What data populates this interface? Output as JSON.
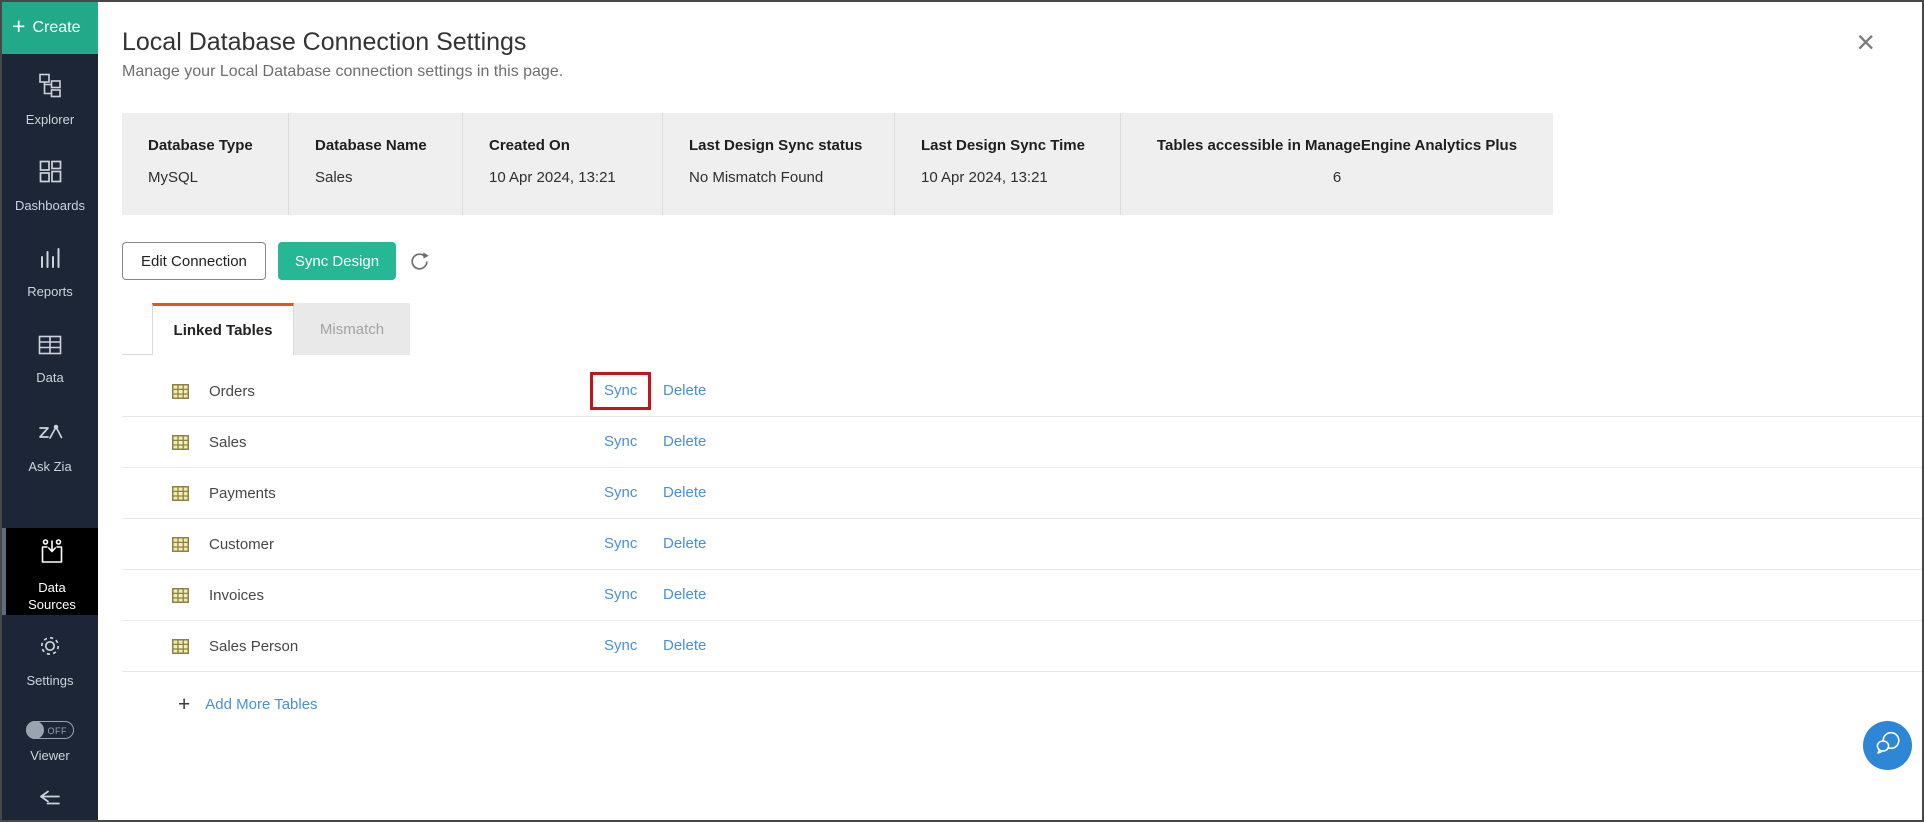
{
  "colors": {
    "accent-green": "#22a98a",
    "sync-green": "#26b795",
    "tab-orange": "#e2571d",
    "link-blue": "#4a90d9",
    "highlight-red": "#c3161c",
    "fab-blue": "#2e86d6",
    "sidebar-bg": "#1d2637",
    "sidebar-active-bg": "#000000",
    "sidebar-text": "#cdd3dc"
  },
  "icons": {
    "plus": "+",
    "close": "×"
  },
  "sidebar": {
    "create_label": "Create",
    "items": [
      {
        "label": "Explorer"
      },
      {
        "label": "Dashboards"
      },
      {
        "label": "Reports"
      },
      {
        "label": "Data"
      },
      {
        "label": "Ask Zia"
      },
      {
        "label": "Data Sources"
      },
      {
        "label": "Settings"
      },
      {
        "label": "Viewer",
        "toggle": "OFF"
      }
    ]
  },
  "header": {
    "title": "Local Database Connection Settings",
    "subtitle": "Manage your Local Database connection settings in this page."
  },
  "info_bar": [
    {
      "label": "Database Type",
      "value": "MySQL"
    },
    {
      "label": "Database Name",
      "value": "Sales"
    },
    {
      "label": "Created On",
      "value": "10 Apr 2024, 13:21"
    },
    {
      "label": "Last Design Sync status",
      "value": "No Mismatch Found"
    },
    {
      "label": "Last Design Sync Time",
      "value": "10 Apr 2024, 13:21"
    },
    {
      "label": "Tables accessible in ManageEngine Analytics Plus",
      "value": "6"
    }
  ],
  "actions": {
    "edit_connection": "Edit Connection",
    "sync_design": "Sync Design"
  },
  "tabs": [
    {
      "label": "Linked Tables"
    },
    {
      "label": "Mismatch"
    }
  ],
  "tables": [
    {
      "name": "Orders",
      "sync": "Sync",
      "delete": "Delete"
    },
    {
      "name": "Sales",
      "sync": "Sync",
      "delete": "Delete"
    },
    {
      "name": "Payments",
      "sync": "Sync",
      "delete": "Delete"
    },
    {
      "name": "Customer",
      "sync": "Sync",
      "delete": "Delete"
    },
    {
      "name": "Invoices",
      "sync": "Sync",
      "delete": "Delete"
    },
    {
      "name": "Sales Person",
      "sync": "Sync",
      "delete": "Delete"
    }
  ],
  "footer": {
    "add_more_tables": "Add More Tables"
  }
}
